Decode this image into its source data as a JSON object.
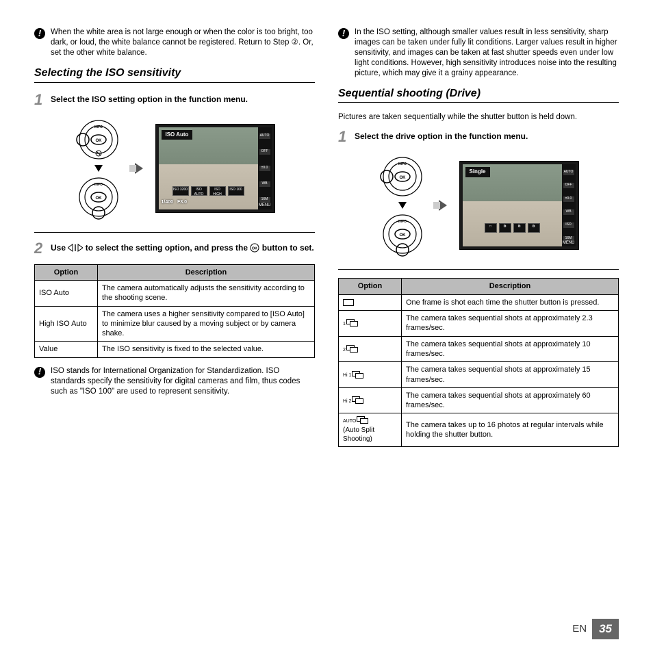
{
  "left": {
    "note1": "When the white area is not large enough or when the color is too bright, too dark, or loud, the white balance cannot be registered. Return to Step ②. Or, set the other white balance.",
    "section_title": "Selecting the ISO sensitivity",
    "step1_text": "Select the ISO setting option in the function menu.",
    "screen1_label": "ISO Auto",
    "screen1_bottom_left": "1/400",
    "screen1_bottom_right": "F3.0",
    "menu": "MENU",
    "iso_chips": [
      "ISO 3200",
      "ISO AUTO",
      "ISO HIGH",
      "ISO 100"
    ],
    "side_labels": [
      "AUTO",
      "OFF",
      "±0.0",
      "WB",
      "16M"
    ],
    "step2_text_a": "Use ",
    "step2_text_b": " to select the setting option, and press the ",
    "step2_text_c": " button to set.",
    "table_headers": [
      "Option",
      "Description"
    ],
    "table_rows": [
      {
        "opt": "ISO Auto",
        "desc": "The camera automatically adjusts the sensitivity according to the shooting scene."
      },
      {
        "opt": "High ISO Auto",
        "desc": "The camera uses a higher sensitivity compared to [ISO Auto] to minimize blur caused by a moving subject or by camera shake."
      },
      {
        "opt": "Value",
        "desc": "The ISO sensitivity is fixed to the selected value."
      }
    ],
    "note2": "ISO stands for International Organization for Standardization. ISO standards specify the sensitivity for digital cameras and film, thus codes such as \"ISO 100\" are used to represent sensitivity."
  },
  "right": {
    "note1": "In the ISO setting, although smaller values result in less sensitivity, sharp images can be taken under fully lit conditions. Larger values result in higher sensitivity, and images can be taken at fast shutter speeds even under low light conditions. However, high sensitivity introduces noise into the resulting picture, which may give it a grainy appearance.",
    "section_title": "Sequential shooting (Drive)",
    "intro": "Pictures are taken sequentially while the shutter button is held down.",
    "step1_text": "Select the drive option in the function menu.",
    "screen_label": "Single",
    "side_labels": [
      "AUTO",
      "OFF",
      "±0.0",
      "WB",
      "ISO",
      "16M"
    ],
    "menu": "MENU",
    "table_headers": [
      "Option",
      "Description"
    ],
    "table_rows": [
      {
        "icon": "single",
        "sub": "",
        "desc": "One frame is shot each time the shutter button is pressed."
      },
      {
        "icon": "burst",
        "sub": "1",
        "desc": "The camera takes sequential shots at approximately 2.3 frames/sec."
      },
      {
        "icon": "burst",
        "sub": "2",
        "desc": "The camera takes sequential shots at approximately 10 frames/sec."
      },
      {
        "icon": "burst",
        "sub": "Hi 1",
        "desc": "The camera takes sequential shots at approximately 15 frames/sec."
      },
      {
        "icon": "burst",
        "sub": "Hi 2",
        "desc": "The camera takes sequential shots at approximately 60 frames/sec."
      },
      {
        "icon": "burst",
        "sub": "AUTO",
        "extra": "(Auto Split Shooting)",
        "desc": "The camera takes up to 16 photos at regular intervals while holding the shutter button."
      }
    ]
  },
  "footer": {
    "lang": "EN",
    "page": "35"
  },
  "dial": {
    "info": "INFO",
    "ok": "OK"
  }
}
